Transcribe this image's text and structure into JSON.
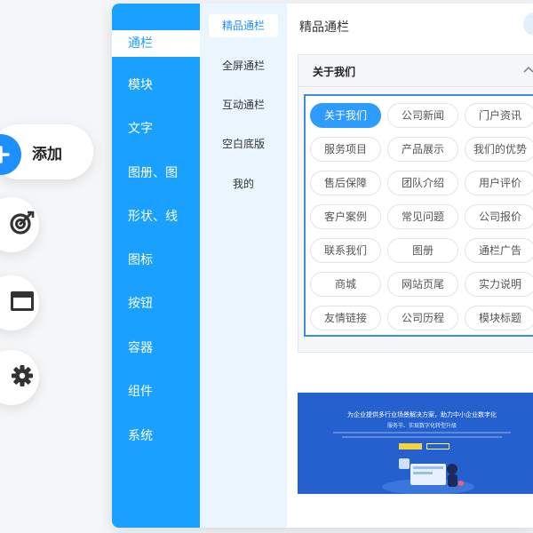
{
  "toolbar": {
    "add_label": "添加",
    "icons": [
      "plus-icon",
      "target-icon",
      "window-icon",
      "gear-icon"
    ]
  },
  "categories": [
    {
      "label": "通栏",
      "active": true
    },
    {
      "label": "模块"
    },
    {
      "label": "文字"
    },
    {
      "label": "图册、图"
    },
    {
      "label": "形状、线"
    },
    {
      "label": "图标"
    },
    {
      "label": "按钮"
    },
    {
      "label": "容器"
    },
    {
      "label": "组件"
    },
    {
      "label": "系统"
    }
  ],
  "subcategories": [
    {
      "label": "精品通栏",
      "active": true
    },
    {
      "label": "全屏通栏"
    },
    {
      "label": "互动通栏"
    },
    {
      "label": "空白底版"
    },
    {
      "label": "我的"
    }
  ],
  "content": {
    "title": "精品通栏",
    "card_title": "关于我们",
    "tags": [
      "关于我们",
      "公司新闻",
      "门户资讯",
      "服务项目",
      "产品展示",
      "我们的优势",
      "售后保障",
      "团队介绍",
      "用户评价",
      "客户案例",
      "常见问题",
      "公司报价",
      "联系我们",
      "图册",
      "通栏广告",
      "商城",
      "网站页尾",
      "实力说明",
      "友情链接",
      "公司历程",
      "模块标题"
    ],
    "active_tag": "关于我们",
    "promo_heading": "为企业提供多行业场景解决方案，助力中小企业数字化",
    "promo_sub": "服务节、实现数字化转型升级"
  },
  "colors": {
    "accent": "#1aa0ff",
    "tag_active": "#2e9bff",
    "promo_bg": "#2461cf",
    "sub_bg": "#eaf5ff"
  }
}
